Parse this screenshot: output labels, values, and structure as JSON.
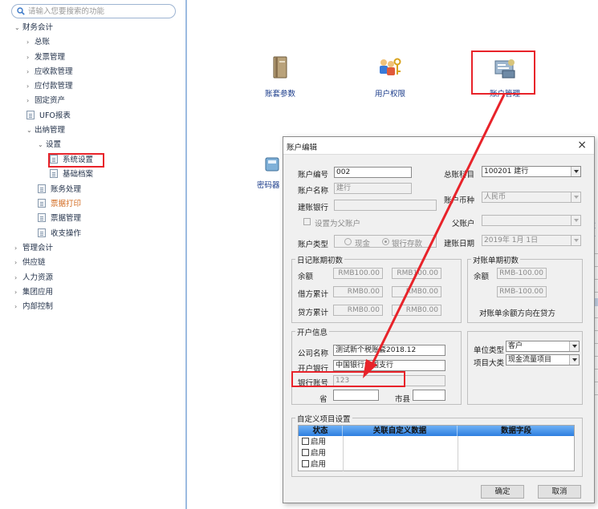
{
  "sidebar": {
    "search_placeholder": "请输入您要搜索的功能",
    "items": [
      {
        "label": "财务会计"
      },
      {
        "label": "总账"
      },
      {
        "label": "发票管理"
      },
      {
        "label": "应收款管理"
      },
      {
        "label": "应付款管理"
      },
      {
        "label": "固定资产"
      },
      {
        "label": "UFO报表"
      },
      {
        "label": "出纳管理"
      },
      {
        "label": "设置"
      },
      {
        "label": "系统设置"
      },
      {
        "label": "基础档案"
      },
      {
        "label": "账务处理"
      },
      {
        "label": "票据打印"
      },
      {
        "label": "票据管理"
      },
      {
        "label": "收支操作"
      },
      {
        "label": "管理会计"
      },
      {
        "label": "供应链"
      },
      {
        "label": "人力资源"
      },
      {
        "label": "集团应用"
      },
      {
        "label": "内部控制"
      }
    ]
  },
  "workspace": {
    "icons": [
      {
        "label": "账套参数"
      },
      {
        "label": "用户权限"
      },
      {
        "label": "账户管理"
      },
      {
        "label": "密码器"
      }
    ]
  },
  "dialog": {
    "title": "账户编辑",
    "close": "×",
    "account_no_label": "账户编号",
    "account_no_value": "002",
    "account_name_label": "账户名称",
    "account_name_value": "建行",
    "bank_label": "建账银行",
    "bank_value": "",
    "parent_chk_label": "设置为父账户",
    "account_type_label": "账户类型",
    "type_cash": "现金",
    "type_bank": "银行存款",
    "subject_label": "总账科目",
    "subject_value": "100201 建行",
    "currency_label": "账户币种",
    "currency_value": "人民币",
    "parent_label": "父账户",
    "parent_value": "",
    "date_label": "建账日期",
    "date_value": "2019年 1月 1日",
    "journal_group": "日记账期初数",
    "balance_label": "余额",
    "debit_label": "借方累计",
    "credit_label": "贷方累计",
    "journal_balance": [
      "RMB100.00",
      "RMB100.00"
    ],
    "journal_debit": [
      "RMB0.00",
      "RMB0.00"
    ],
    "journal_credit": [
      "RMB0.00",
      "RMB0.00"
    ],
    "recon_group": "对账单期初数",
    "recon_balance_label": "余额",
    "recon_values": [
      "RMB-100.00",
      "RMB-100.00"
    ],
    "recon_note": "对账单余额方向在贷方",
    "open_group": "开户信息",
    "company_label": "公司名称",
    "company_value": "测试新个税账套2018.12",
    "open_bank_label": "开户银行",
    "open_bank_value": "中国银行中国支行",
    "bank_acct_label": "银行账号",
    "bank_acct_value": "123",
    "province_label": "省",
    "city_label": "市县",
    "unit_type_label": "单位类型",
    "unit_type_value": "客户",
    "project_label": "项目大类",
    "project_value": "现金流量项目",
    "custom_group": "自定义项目设置",
    "grid_headers": [
      "状态",
      "关联自定义数据",
      "数据字段"
    ],
    "grid_rows": [
      "启用",
      "启用",
      "启用"
    ],
    "ok_button": "确定",
    "cancel_button": "取消"
  },
  "background_peek": [
    "友",
    "号"
  ]
}
